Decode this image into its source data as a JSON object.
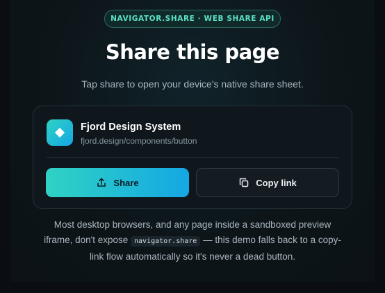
{
  "badge": "NAVIGATOR.SHARE · WEB SHARE API",
  "title": "Share this page",
  "subtitle": "Tap share to open your device's native share sheet.",
  "card": {
    "name": "Fjord Design System",
    "url": "fjord.design/components/button",
    "icon": "diamond-icon"
  },
  "buttons": {
    "share_label": "Share",
    "share_icon": "share-upload-icon",
    "copy_label": "Copy link",
    "copy_icon": "copy-icon"
  },
  "note": {
    "before": "Most desktop browsers, and any page inside a sandboxed preview iframe, don't expose",
    "code": "navigator.share",
    "after": "— this demo falls back to a copy-link flow automatically so it's never a dead button."
  },
  "colors": {
    "accent_start": "#2fd3c3",
    "accent_end": "#15a7e4",
    "badge_text": "#5de0c6",
    "background": "#0a0e13"
  }
}
